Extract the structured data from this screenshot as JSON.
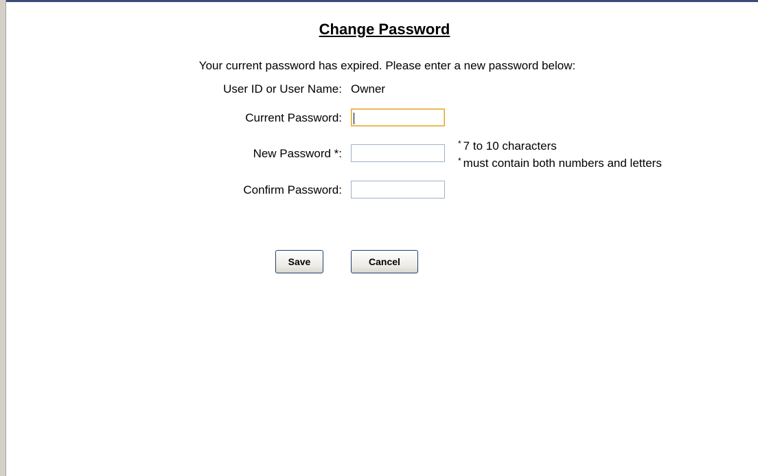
{
  "form": {
    "title": "Change Password",
    "intro": "Your current password has expired. Please enter a new password below:",
    "user_label": "User ID or User Name:",
    "user_value": "Owner",
    "current_password_label": "Current Password:",
    "current_password_value": "",
    "new_password_label": "New Password *:",
    "new_password_value": "",
    "confirm_password_label": "Confirm Password:",
    "confirm_password_value": "",
    "hints": [
      {
        "marker": "*",
        "text": "7 to 10 characters"
      },
      {
        "marker": "*",
        "text": "must contain both numbers and letters"
      }
    ]
  },
  "buttons": {
    "save": "Save",
    "cancel": "Cancel"
  },
  "colors": {
    "focus_border": "#e3a32e",
    "field_border": "#9fb1c8",
    "button_border": "#1e3f6e"
  }
}
